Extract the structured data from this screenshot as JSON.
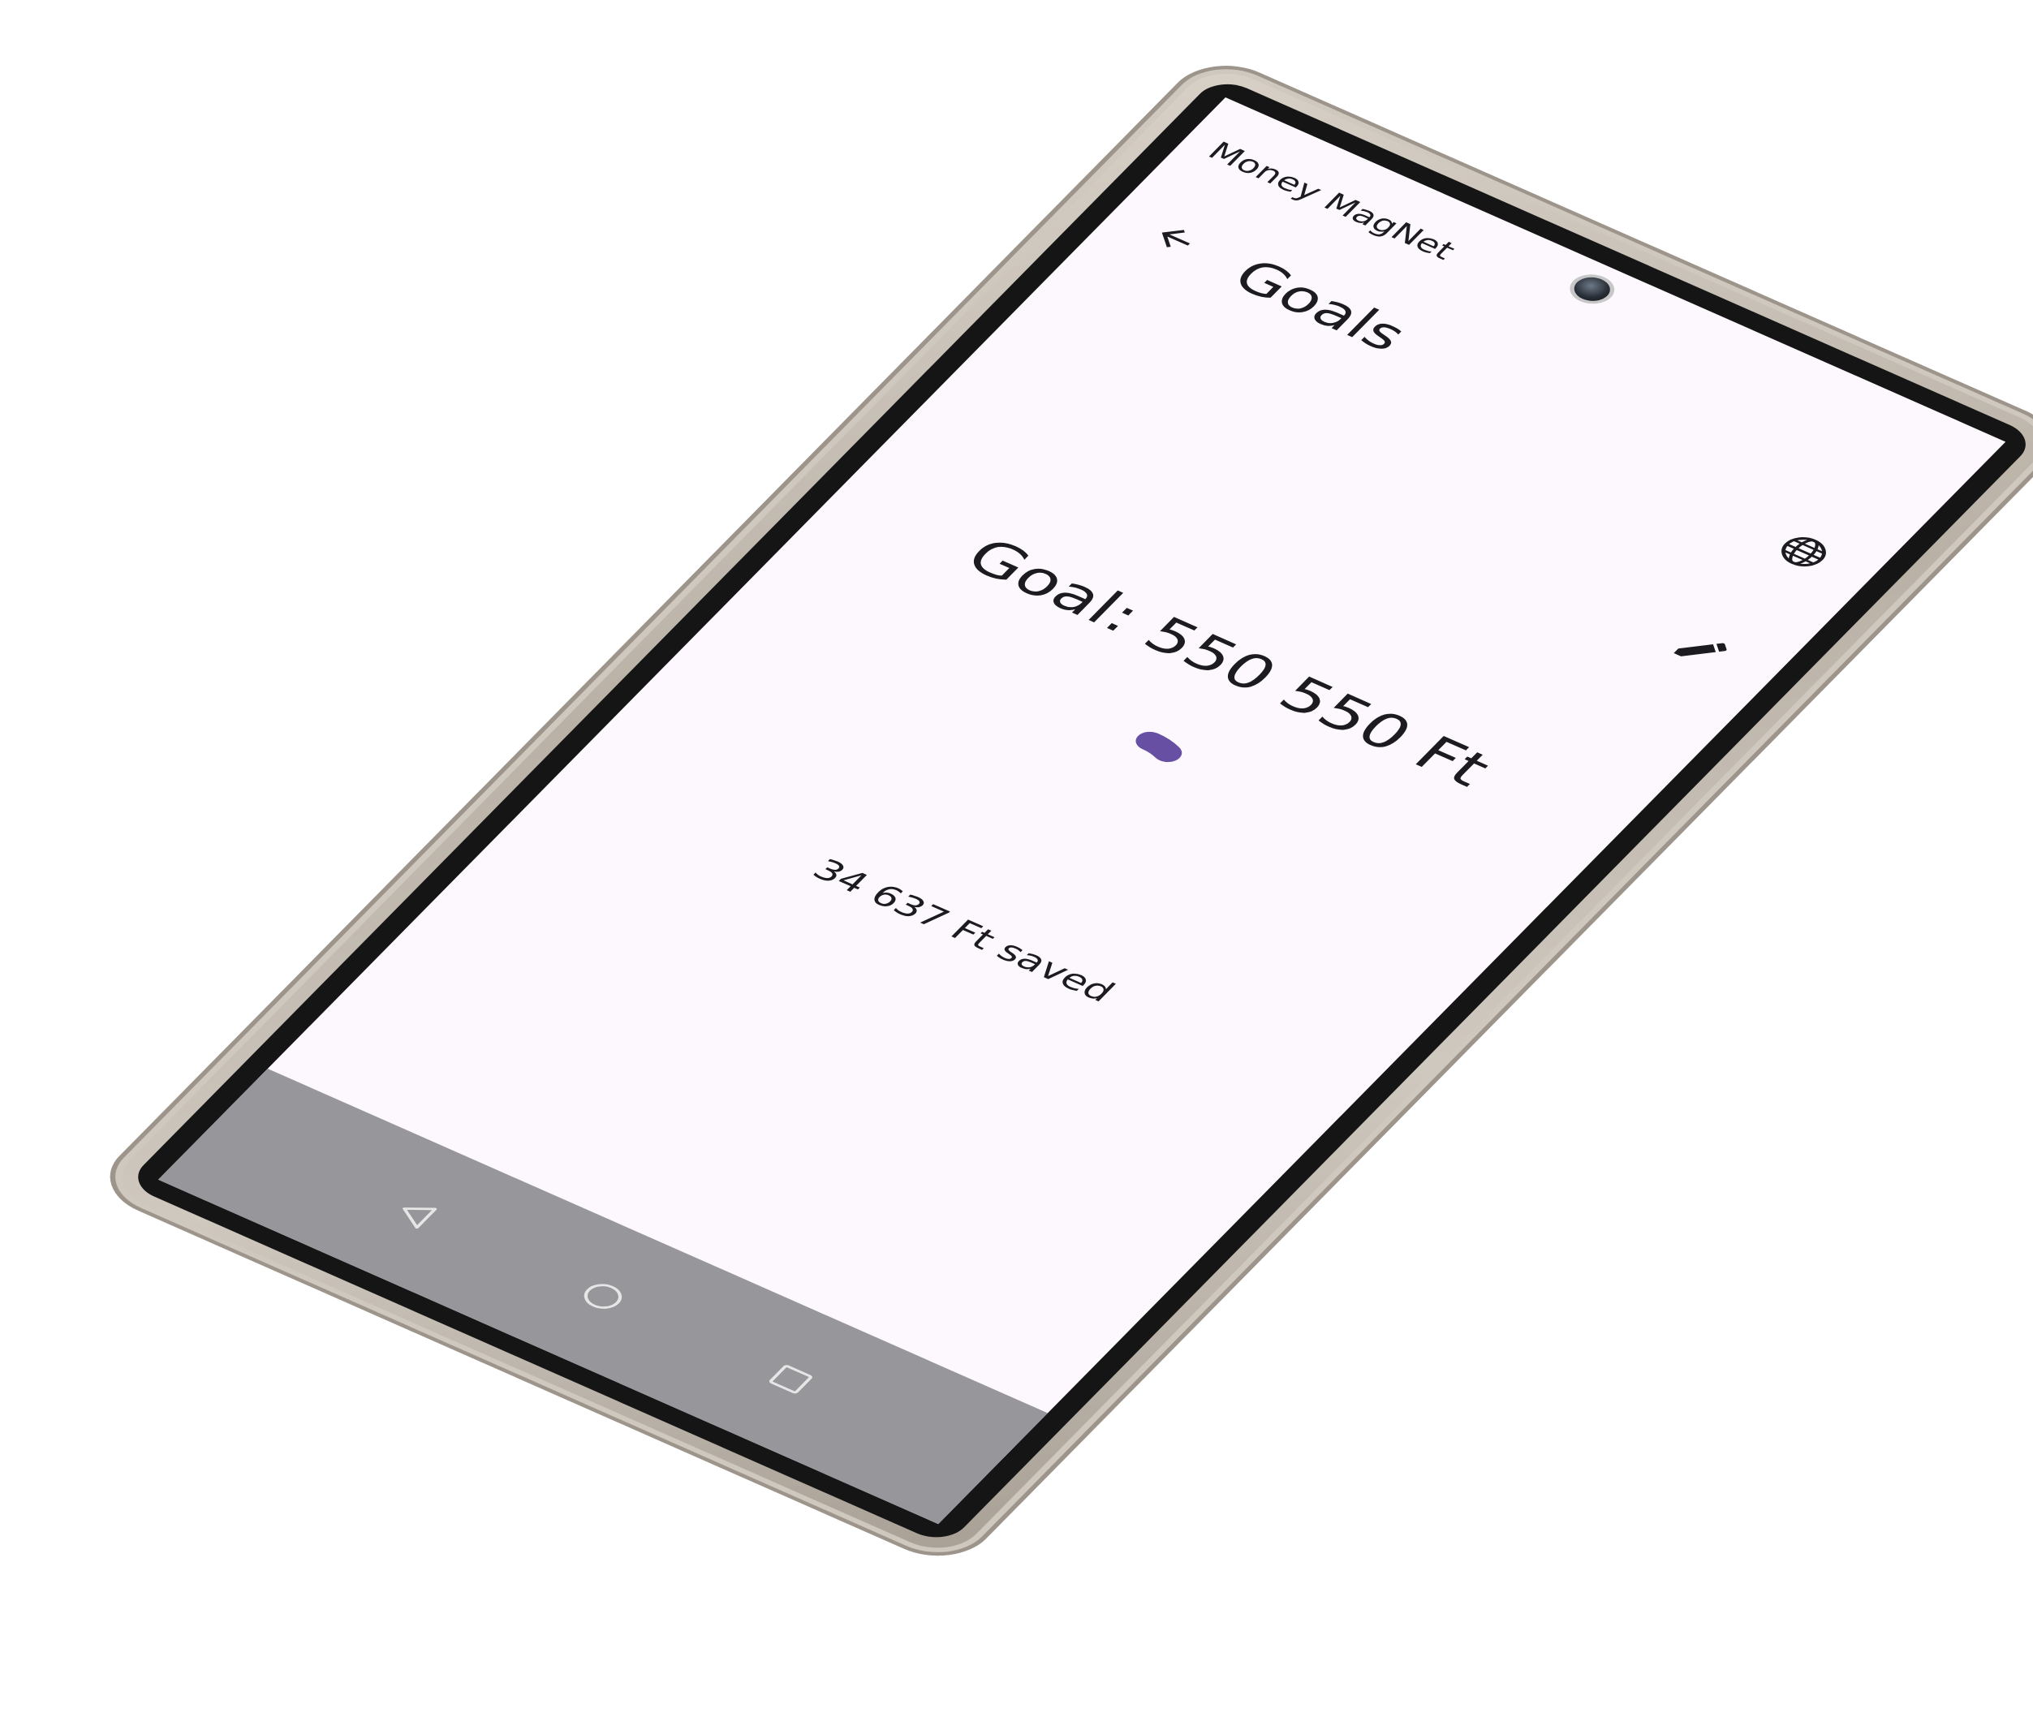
{
  "app": {
    "name": "Money MagNet"
  },
  "status_bar": {
    "time": "",
    "icons": ""
  },
  "top_app_bar": {
    "title": "Goals",
    "back_icon": "arrow-back-icon",
    "language_icon": "globe-icon",
    "edit_icon": "pencil-icon"
  },
  "goal": {
    "label": "Goal: 550 550 Ft",
    "saved_label": "34 637 Ft saved",
    "progress": 0.063,
    "accent_color": "#6750a4"
  },
  "nav_bar": {
    "back_icon": "triangle-back-icon",
    "home_icon": "circle-home-icon",
    "recents_icon": "square-recents-icon"
  }
}
